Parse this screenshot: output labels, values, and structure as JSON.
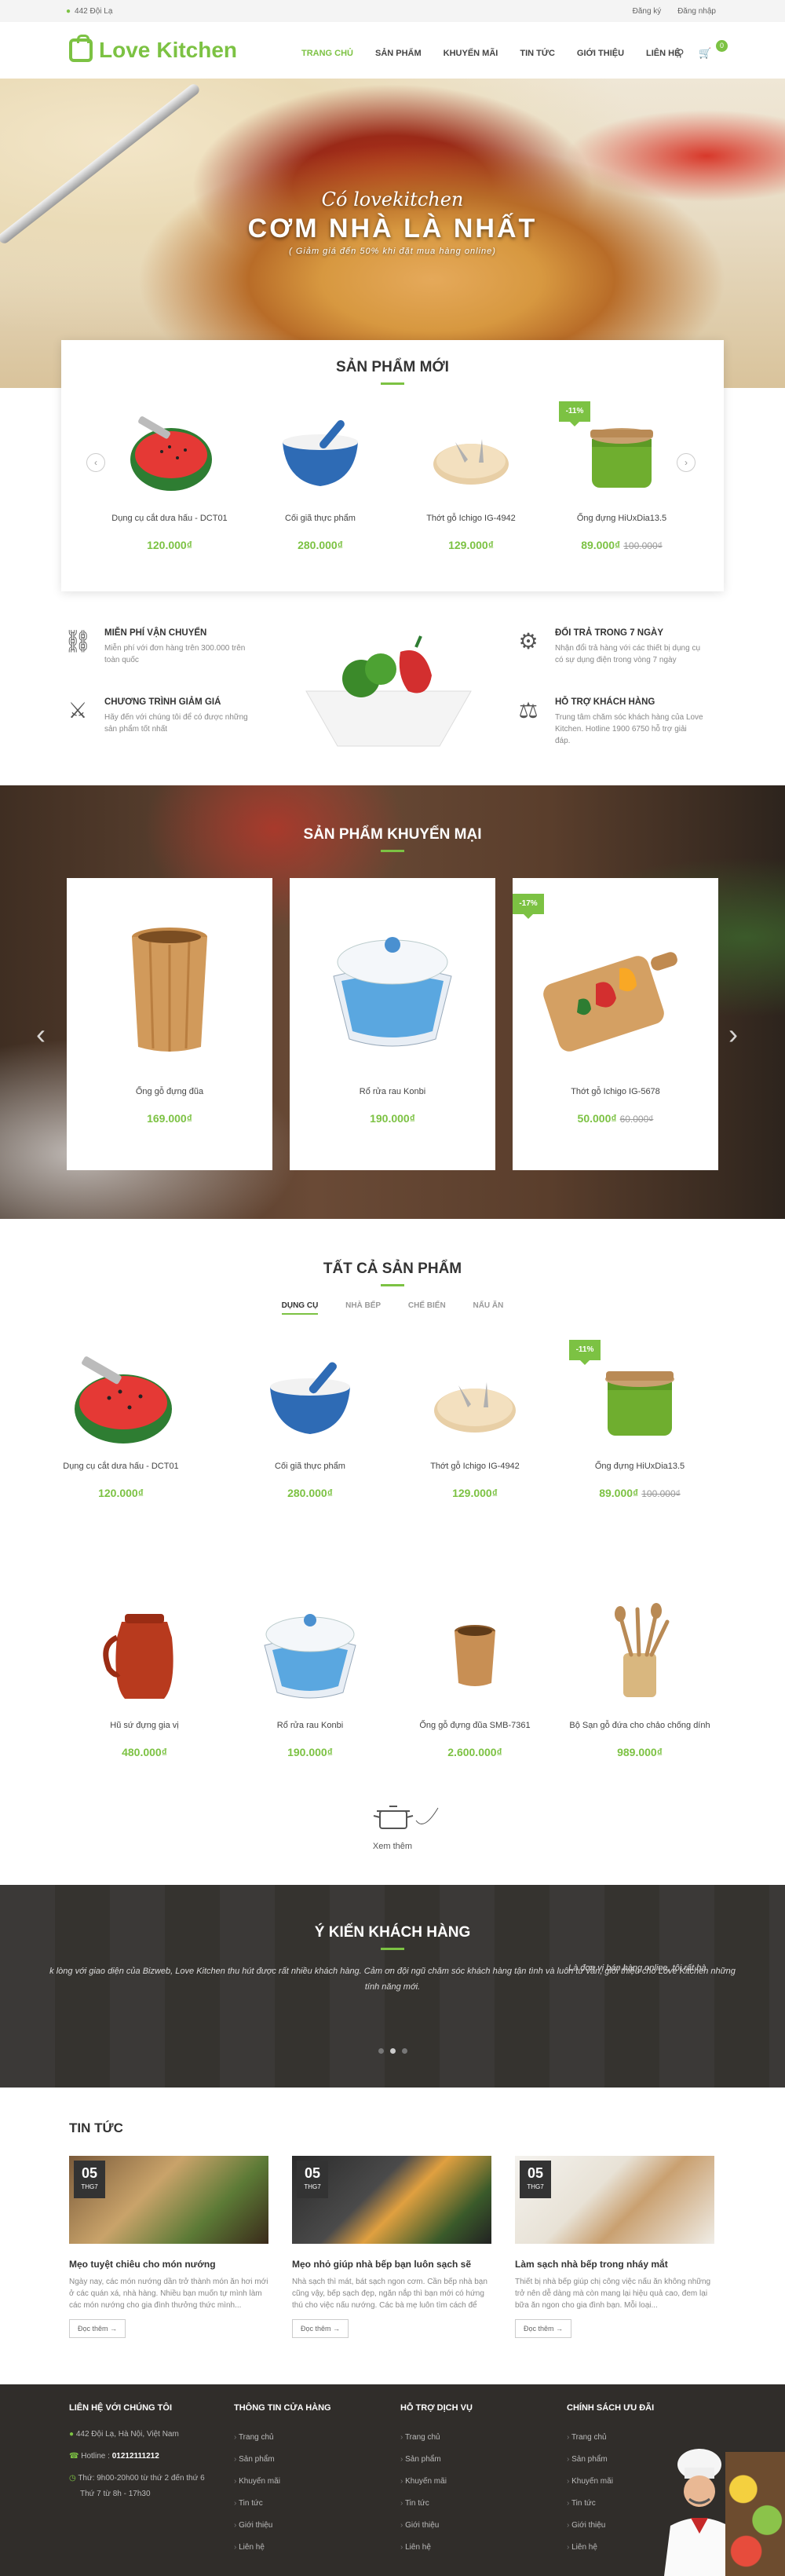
{
  "topbar": {
    "address": "442 Đội Lạ",
    "register": "Đăng ký",
    "login": "Đăng nhập"
  },
  "brand": {
    "logo_word1": "Love",
    "logo_word2": "Kitchen",
    "accent": "#7cc243"
  },
  "nav": {
    "items": [
      "TRANG CHỦ",
      "SẢN PHẨM",
      "KHUYẾN MÃI",
      "TIN TỨC",
      "GIỚI THIỆU",
      "LIÊN HỆ"
    ],
    "cart_count": "0"
  },
  "hero": {
    "subtitle": "Có lovekitchen",
    "title": "CƠM NHÀ LÀ NHẤT",
    "note": "( Giảm giá đến 50% khi đặt mua hàng online)"
  },
  "new_products": {
    "title": "SẢN PHẨM MỚI",
    "items": [
      {
        "name": "Dụng cụ cắt dưa hấu - DCT01",
        "price": "120.000₫",
        "old": "",
        "badge": ""
      },
      {
        "name": "Cối giã thực phẩm",
        "price": "280.000₫",
        "old": "",
        "badge": ""
      },
      {
        "name": "Thớt gỗ Ichigo IG-4942",
        "price": "129.000₫",
        "old": "",
        "badge": ""
      },
      {
        "name": "Ống đựng HiUxDia13.5",
        "price": "89.000₫",
        "old": "100.000₫",
        "badge": "-11%"
      }
    ]
  },
  "features": [
    {
      "title": "MIỄN PHÍ VẬN CHUYỂN",
      "desc": "Miễn phí với đơn hàng trên 300.000 trên toàn quốc"
    },
    {
      "title": "CHƯƠNG TRÌNH GIẢM GIÁ",
      "desc": "Hãy đến với chúng tôi để có được những sản phẩm tốt nhất"
    },
    {
      "title": "ĐỔI TRẢ TRONG 7 NGÀY",
      "desc": "Nhận đổi trả hàng với các thiết bị dụng cụ có sự dụng điện trong vòng 7 ngày"
    },
    {
      "title": "HỖ TRỢ KHÁCH HÀNG",
      "desc": "Trung tâm chăm sóc khách hàng của Love Kitchen. Hotline 1900 6750 hỗ trợ giải đáp."
    }
  ],
  "promo": {
    "title": "SẢN PHẨM KHUYẾN MẠI",
    "items": [
      {
        "name": "Ống gỗ đựng đũa",
        "price": "169.000₫",
        "old": "",
        "badge": ""
      },
      {
        "name": "Rổ rửa rau Konbi",
        "price": "190.000₫",
        "old": "",
        "badge": ""
      },
      {
        "name": "Thớt gỗ Ichigo IG-5678",
        "price": "50.000₫",
        "old": "60.000₫",
        "badge": "-17%"
      }
    ]
  },
  "all_products": {
    "title": "TẤT CẢ SẢN PHẨM",
    "tabs": [
      "DỤNG CỤ",
      "NHÀ BẾP",
      "CHẾ BIẾN",
      "NẤU ĂN"
    ],
    "items": [
      {
        "name": "Dụng cụ cắt dưa hấu - DCT01",
        "price": "120.000₫",
        "old": "",
        "badge": ""
      },
      {
        "name": "Cối giã thực phẩm",
        "price": "280.000₫",
        "old": "",
        "badge": ""
      },
      {
        "name": "Thớt gỗ Ichigo IG-4942",
        "price": "129.000₫",
        "old": "",
        "badge": ""
      },
      {
        "name": "Ống đựng HiUxDia13.5",
        "price": "89.000₫",
        "old": "100.000₫",
        "badge": "-11%"
      },
      {
        "name": "Hũ sứ đựng gia vị",
        "price": "480.000₫",
        "old": "",
        "badge": ""
      },
      {
        "name": "Rổ rửa rau Konbi",
        "price": "190.000₫",
        "old": "",
        "badge": ""
      },
      {
        "name": "Ống gỗ đựng đũa SMB-7361",
        "price": "2.600.000₫",
        "old": "",
        "badge": ""
      },
      {
        "name": "Bộ Sạn gỗ đứa cho chảo chống dính",
        "price": "989.000₫",
        "old": "",
        "badge": ""
      }
    ],
    "more": "Xem thêm"
  },
  "testimonials": {
    "title": "Ý KIẾN KHÁCH HÀNG",
    "quote": "k lòng với giao diện của Bizweb, Love Kitchen thu hút được rất nhiều khách hàng. Cảm ơn đội ngũ chăm sóc khách hàng tận tình và luôn tư vấn, giới thiệu cho Love Kitchen những tính năng mới.",
    "quote_right": "Là đơn vị bán hàng online, tôi rất hà"
  },
  "news": {
    "title": "TIN TỨC",
    "items": [
      {
        "day": "05",
        "month": "THG7",
        "title": "Mẹo tuyệt chiêu cho món nướng",
        "desc": "Ngày nay, các món nướng dần trở thành món ăn hơi mới ở các quán xá, nhà hàng. Nhiều bạn muốn tự mình làm các món nướng cho gia đình thưởng thức mình...",
        "btn": "Đọc thêm →"
      },
      {
        "day": "05",
        "month": "THG7",
        "title": "Mẹo nhỏ giúp nhà bếp bạn luôn sạch sẽ",
        "desc": "Nhà sạch thì mát, bát sạch ngon cơm. Cần bếp nhà bạn cũng vậy, bếp sạch đẹp, ngăn nắp thì bạn mới có hứng thú cho việc nấu nướng. Các bà mẹ luôn tìm cách để làm...",
        "btn": "Đọc thêm →"
      },
      {
        "day": "05",
        "month": "THG7",
        "title": "Làm sạch nhà bếp trong nháy mắt",
        "desc": "Thiết bị nhà bếp giúp chị công việc nấu ăn không những trở nên dễ dàng mà còn mang lại hiệu quả cao, đem lại bữa ăn ngon cho gia đình bạn. Mỗi loại...",
        "btn": "Đọc thêm →"
      }
    ]
  },
  "footer": {
    "contact": {
      "title": "LIÊN HỆ VỚI CHÚNG TÔI",
      "address": "442 Đội Lạ, Hà Nội, Việt Nam",
      "hotline_label": "Hotline :",
      "hotline": "01212111212",
      "hours1": "Thứ: 9h00-20h00 từ thứ 2 đến thứ 6",
      "hours2": "Thứ 7 từ 8h - 17h30"
    },
    "col2": {
      "title": "THÔNG TIN CỬA HÀNG",
      "links": [
        "Trang chủ",
        "Sản phẩm",
        "Khuyến mãi",
        "Tin tức",
        "Giới thiệu",
        "Liên hệ"
      ]
    },
    "col3": {
      "title": "HỖ TRỢ DỊCH VỤ",
      "links": [
        "Trang chủ",
        "Sản phẩm",
        "Khuyến mãi",
        "Tin tức",
        "Giới thiệu",
        "Liên hệ"
      ]
    },
    "col4": {
      "title": "CHÍNH SÁCH ƯU ĐÃI",
      "links": [
        "Trang chủ",
        "Sản phẩm",
        "Khuyến mãi",
        "Tin tức",
        "Giới thiệu",
        "Liên hệ"
      ]
    }
  }
}
